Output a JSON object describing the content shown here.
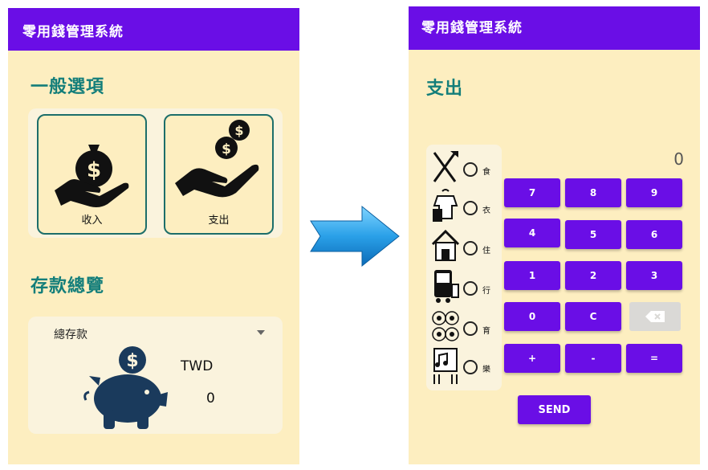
{
  "app_title": "零用錢管理系統",
  "left_screen": {
    "general_title": "一般選項",
    "income_label": "收入",
    "expense_label": "支出",
    "savings_title": "存款總覽",
    "dropdown_selected": "總存款",
    "currency": "TWD",
    "balance": "0"
  },
  "right_screen": {
    "title": "支出",
    "display_value": "0",
    "categories": [
      {
        "label": "食",
        "icon": "fork-knife-icon"
      },
      {
        "label": "衣",
        "icon": "clothes-icon"
      },
      {
        "label": "住",
        "icon": "house-icon"
      },
      {
        "label": "行",
        "icon": "bus-icon"
      },
      {
        "label": "育",
        "icon": "education-icon"
      },
      {
        "label": "樂",
        "icon": "entertainment-icon"
      }
    ],
    "keys": {
      "k7": "7",
      "k8": "8",
      "k9": "9",
      "k4": "4",
      "k5": "5",
      "k6": "6",
      "k1": "1",
      "k2": "2",
      "k3": "3",
      "k0": "0",
      "kc": "C",
      "plus": "+",
      "minus": "-",
      "equals": "="
    },
    "send_label": "SEND"
  },
  "colors": {
    "app_bar": "#6a0ee6",
    "background": "#fdeec0",
    "title_teal": "#137e7a",
    "key_purple": "#6a0ee6"
  }
}
